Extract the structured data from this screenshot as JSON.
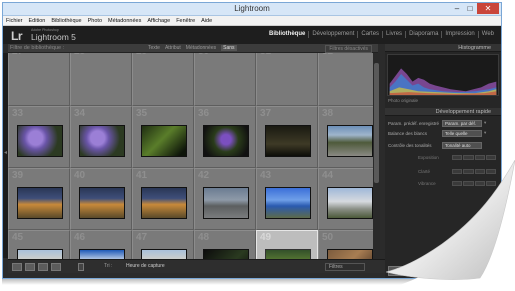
{
  "window": {
    "title": "Lightroom",
    "controls": {
      "minimize": "–",
      "maximize": "□",
      "close": "✕"
    }
  },
  "menubar": [
    "Fichier",
    "Edition",
    "Bibliothèque",
    "Photo",
    "Métadonnées",
    "Affichage",
    "Fenêtre",
    "Aide"
  ],
  "identity": {
    "logo": "Lr",
    "small": "Adobe Photoshop",
    "name": "Lightroom 5"
  },
  "modules": [
    "Bibliothèque",
    "Développement",
    "Cartes",
    "Livres",
    "Diaporama",
    "Impression",
    "Web"
  ],
  "active_module": "Bibliothèque",
  "filter_bar": {
    "title": "Filtre de bibliothèque :",
    "tabs": [
      "Texte",
      "Attribut",
      "Métadonnées",
      "Sans"
    ],
    "active_tab": "Sans",
    "preset": "Filtres désactivés"
  },
  "grid": {
    "cells": [
      {
        "num": "27",
        "thumb": "blank"
      },
      {
        "num": "28",
        "thumb": "blank"
      },
      {
        "num": "29",
        "thumb": "blank"
      },
      {
        "num": "30",
        "thumb": "blank"
      },
      {
        "num": "31",
        "thumb": "blank"
      },
      {
        "num": "32",
        "thumb": "blank"
      },
      {
        "num": "33",
        "thumb": "lilac-flowers"
      },
      {
        "num": "34",
        "thumb": "lilac-flowers"
      },
      {
        "num": "35",
        "thumb": "garden-green"
      },
      {
        "num": "36",
        "thumb": "purple-flowers"
      },
      {
        "num": "37",
        "thumb": "dark-garden"
      },
      {
        "num": "38",
        "thumb": "street-trees"
      },
      {
        "num": "39",
        "thumb": "house-evening"
      },
      {
        "num": "40",
        "thumb": "house-evening"
      },
      {
        "num": "41",
        "thumb": "house-evening"
      },
      {
        "num": "42",
        "thumb": "street-road"
      },
      {
        "num": "43",
        "thumb": "road-sign"
      },
      {
        "num": "44",
        "thumb": "white-house"
      },
      {
        "num": "45",
        "thumb": "houses-lawn"
      },
      {
        "num": "46",
        "thumb": "sign-building"
      },
      {
        "num": "47",
        "thumb": "houses-lawn"
      },
      {
        "num": "48",
        "thumb": "dark-room"
      },
      {
        "num": "49",
        "thumb": "person-garden"
      },
      {
        "num": "50",
        "thumb": "brick-interior"
      }
    ],
    "selected_num": "49"
  },
  "toolbar": {
    "sort_label": "Tri :",
    "sort_value": "Heure de capture",
    "filter_label": "Filtres"
  },
  "right_panel": {
    "histogram_title": "Histogramme",
    "original_photo": "Photo originale",
    "quick_develop_title": "Développement rapide",
    "saved_preset_label": "Param. prédéf. enregistré",
    "saved_preset_value": "Param. par déf.",
    "white_balance_label": "Balance des blancs",
    "white_balance_value": "Telle quelle",
    "tone_control_label": "Contrôle des tonalités",
    "tone_control_value": "Tonalité auto",
    "levels": [
      "Exposition",
      "Clarté",
      "Vibrance"
    ],
    "sync_button": "Par défaut",
    "reset_button": "Rétablir tout"
  },
  "colors": {
    "accent": "#7aa7d6",
    "selected_cell": "#bdbdbd",
    "cell": "#7a7a7a",
    "panel": "#262626"
  }
}
